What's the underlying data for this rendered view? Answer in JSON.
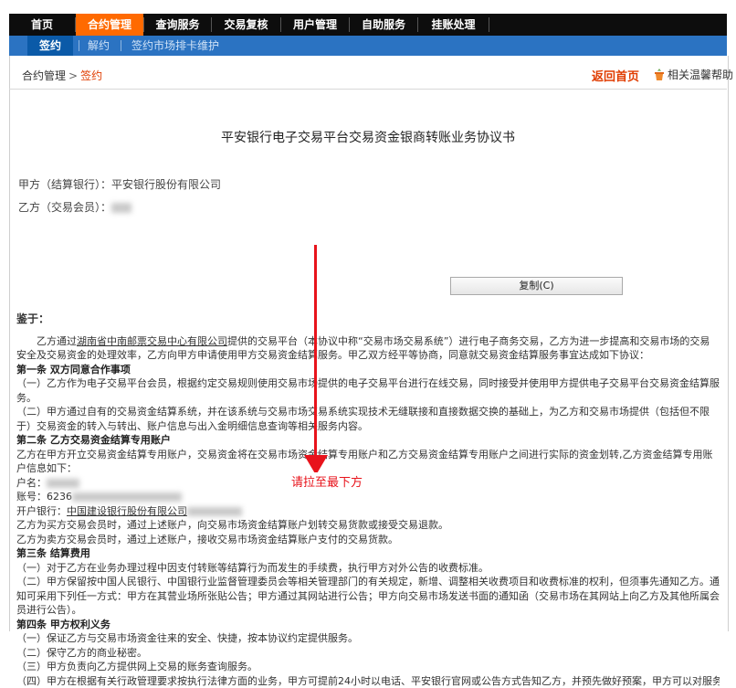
{
  "topnav": {
    "tabs": [
      {
        "label": "首页",
        "active": false
      },
      {
        "label": "合约管理",
        "active": true
      },
      {
        "label": "查询服务",
        "active": false
      },
      {
        "label": "交易复核",
        "active": false
      },
      {
        "label": "用户管理",
        "active": false
      },
      {
        "label": "自助服务",
        "active": false
      },
      {
        "label": "挂账处理",
        "active": false
      }
    ]
  },
  "subnav": {
    "items": [
      {
        "label": "签约",
        "active": true
      },
      {
        "label": "解约",
        "active": false
      },
      {
        "label": "签约市场排卡维护",
        "active": false
      }
    ]
  },
  "breadcrumb": {
    "parent": "合约管理",
    "arrow": ">",
    "current": "签约"
  },
  "header_links": {
    "home": "返回首页",
    "help": "相关温馨帮助"
  },
  "document": {
    "title": "平安银行电子交易平台交易资金银商转账业务协议书",
    "party_a": "甲方（结算银行）：平安银行股份有限公司",
    "party_b": "乙方（交易会员）：",
    "copy_button": "复制(C)",
    "preface_label": "鉴于：",
    "intro_1": "乙方通过",
    "intro_link": "湖南省中南邮票交易中心有限公司",
    "intro_2": "提供的交易平台（本协议中称“交易市场交易系统”）进行电子商务交易，乙方为进一步提高和交易市场的交易安全及交易资金的处理效率，乙方向甲方申请使用甲方交易资金结算服务。甲乙双方经平等协商，同意就交易资金结算服务事宜达成如下协议：",
    "art1": "第一条 双方同意合作事项",
    "art1_1": "（一）乙方作为电子交易平台会员，根据约定交易规则使用交易市场提供的电子交易平台进行在线交易，同时接受并使用甲方提供电子交易平台交易资金结算服务。",
    "art1_2": "（二）甲方通过自有的交易资金结算系统，并在该系统与交易市场交易系统实现技术无缝联接和直接数据交换的基础上，为乙方和交易市场提供（包括但不限于）交易资金的转入与转出、账户信息与出入金明细信息查询等相关服务内容。",
    "art2": "第二条 乙方交易资金结算专用账户",
    "art2_1": "乙方在甲方开立交易资金结算专用账户，交易资金将在交易市场资金结算专用账户和乙方交易资金结算专用账户之间进行实际的资金划转,乙方资金结算专用账户信息如下：",
    "acct_name": "户名：",
    "acct_no": "账号：6236",
    "acct_bank": "开户银行：",
    "acct_bank_name": "中国建设银行股份有限公司",
    "art2_2": "乙方为买方交易会员时，通过上述账户，向交易市场资金结算账户划转交易货款或接受交易退款。",
    "art2_3": "乙方为卖方交易会员时，通过上述账户，接收交易市场资金结算账户支付的交易货款。",
    "art3": "第三条 结算费用",
    "art3_1": "（一）对于乙方在业务办理过程中因支付转账等结算行为而发生的手续费，执行甲方对外公告的收费标准。",
    "art3_2": "（二）甲方保留按中国人民银行、中国银行业监督管理委员会等相关管理部门的有关规定，新增、调整相关收费项目和收费标准的权利，但须事先通知乙方。通知可采用下列任一方式：甲方在其营业场所张贴公告；甲方通过其网站进行公告；甲方向交易市场发送书面的通知函（交易市场在其网站上向乙方及其他所属会员进行公告）。",
    "art4": "第四条 甲方权利义务",
    "art4_1": "（一）保证乙方与交易市场资金往来的安全、快捷，按本协议约定提供服务。",
    "art4_2": "（二）保守乙方的商业秘密。",
    "art4_3": "（三）甲方负责向乙方提供网上交易的账务查询服务。",
    "art4_4": "（四）甲方在根据有关行政管理要求按执行法律方面的业务，甲方可提前24小时以电话、平安银行官网或公告方式告知乙方，并预先做好预案，甲方可以对服务进行必要的…"
  },
  "annotation": {
    "text": "请拉至最下方",
    "color": "#e8131b"
  }
}
